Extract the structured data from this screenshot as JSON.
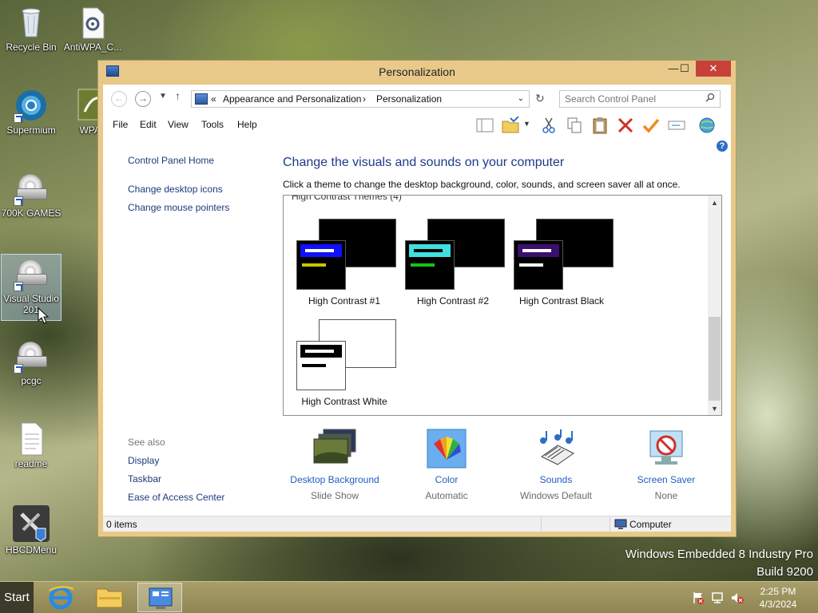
{
  "desktop": {
    "icons": [
      {
        "label": "Recycle Bin",
        "icon": "recycle-bin-icon"
      },
      {
        "label": "AntiWPA_C...",
        "icon": "settings-file-icon"
      },
      {
        "label": "Supermium",
        "icon": "browser-icon"
      },
      {
        "label": "WPA_",
        "icon": "app-icon"
      },
      {
        "label": "700K GAMES",
        "icon": "disc-drive-icon"
      },
      {
        "label": "Visual Studio 201",
        "icon": "disc-drive-icon"
      },
      {
        "label": "pcgc",
        "icon": "disc-drive-icon"
      },
      {
        "label": "readme",
        "icon": "text-file-icon"
      },
      {
        "label": "HBCDMenu",
        "icon": "tools-icon"
      }
    ],
    "watermark": {
      "line1": "Windows Embedded 8 Industry Pro",
      "line2": "Build 9200"
    }
  },
  "window": {
    "title": "Personalization",
    "controls": {
      "minimize": "—",
      "maximize": "☐",
      "close": "✕"
    },
    "address": {
      "prefix": "«",
      "crumb1": "Appearance and Personalization",
      "sep": "›",
      "crumb2": "Personalization"
    },
    "search_placeholder": "Search Control Panel",
    "menu": [
      "File",
      "Edit",
      "View",
      "Tools",
      "Help"
    ],
    "left_pane": {
      "home": "Control Panel Home",
      "links": [
        "Change desktop icons",
        "Change mouse pointers"
      ],
      "see_also_title": "See also",
      "see_also": [
        "Display",
        "Taskbar",
        "Ease of Access Center"
      ]
    },
    "heading": "Change the visuals and sounds on your computer",
    "subtext": "Click a theme to change the desktop background, color, sounds, and screen saver all at once.",
    "theme_group": "High Contrast Themes (4)",
    "themes": [
      {
        "name": "High Contrast #1",
        "back": "#000000",
        "front": "#000000",
        "bar1": "#1010ff",
        "bar1line": "#ffffff",
        "bar2": "#c8c800"
      },
      {
        "name": "High Contrast #2",
        "back": "#000000",
        "front": "#000000",
        "bar1": "#3fe0e0",
        "bar1line": "#000000",
        "bar2": "#18c018"
      },
      {
        "name": "High Contrast Black",
        "back": "#000000",
        "front": "#000000",
        "bar1": "#3a0f6e",
        "bar1line": "#ffffff",
        "bar2": "#ffffff"
      },
      {
        "name": "High Contrast White",
        "back": "#ffffff",
        "front": "#ffffff",
        "bar1": "#000000",
        "bar1line": "#ffffff",
        "bar2": "#000000"
      }
    ],
    "bottom": [
      {
        "label": "Desktop Background",
        "value": "Slide Show",
        "icon": "desktop-background-icon"
      },
      {
        "label": "Color",
        "value": "Automatic",
        "icon": "color-icon"
      },
      {
        "label": "Sounds",
        "value": "Windows Default",
        "icon": "sounds-icon"
      },
      {
        "label": "Screen Saver",
        "value": "None",
        "icon": "screen-saver-icon"
      }
    ],
    "status": {
      "items": "0 items",
      "location": "Computer"
    }
  },
  "taskbar": {
    "start": "Start",
    "time": "2:25 PM",
    "date": "4/3/2024"
  },
  "colors": {
    "link": "#1d3a7a",
    "heading": "#1e3a8a",
    "close": "#c7413a",
    "frame": "#e8c98a"
  }
}
